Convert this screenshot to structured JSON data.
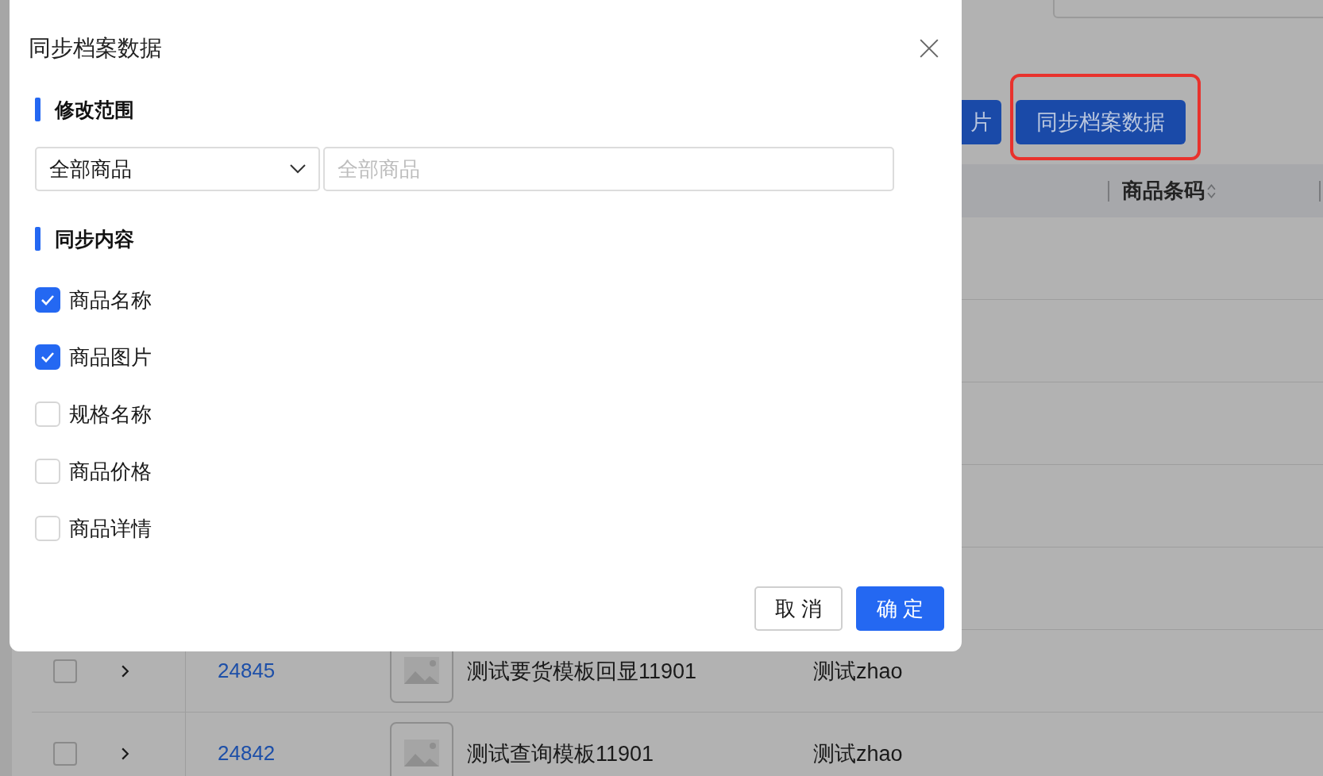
{
  "background": {
    "toolbar_buttons": [
      {
        "label": "片",
        "highlighted": false
      },
      {
        "label": "同步档案数据",
        "highlighted": true
      }
    ],
    "table": {
      "columns": [
        {
          "label": "商品条码"
        }
      ],
      "rows": [
        {
          "checked": false,
          "id": "24845",
          "name": "测试要货模板回显11901",
          "creator": "测试zhao"
        },
        {
          "checked": false,
          "id": "24842",
          "name": "测试查询模板11901",
          "creator": "测试zhao"
        }
      ]
    }
  },
  "dialog": {
    "title": "同步档案数据",
    "scope_heading": "修改范围",
    "scope_select": {
      "value": "全部商品"
    },
    "scope_input": {
      "placeholder": "全部商品"
    },
    "content_heading": "同步内容",
    "options": [
      {
        "label": "商品名称",
        "checked": true
      },
      {
        "label": "商品图片",
        "checked": true
      },
      {
        "label": "规格名称",
        "checked": false
      },
      {
        "label": "商品价格",
        "checked": false
      },
      {
        "label": "商品详情",
        "checked": false
      }
    ],
    "cancel_button": "取 消",
    "confirm_button": "确 定"
  }
}
